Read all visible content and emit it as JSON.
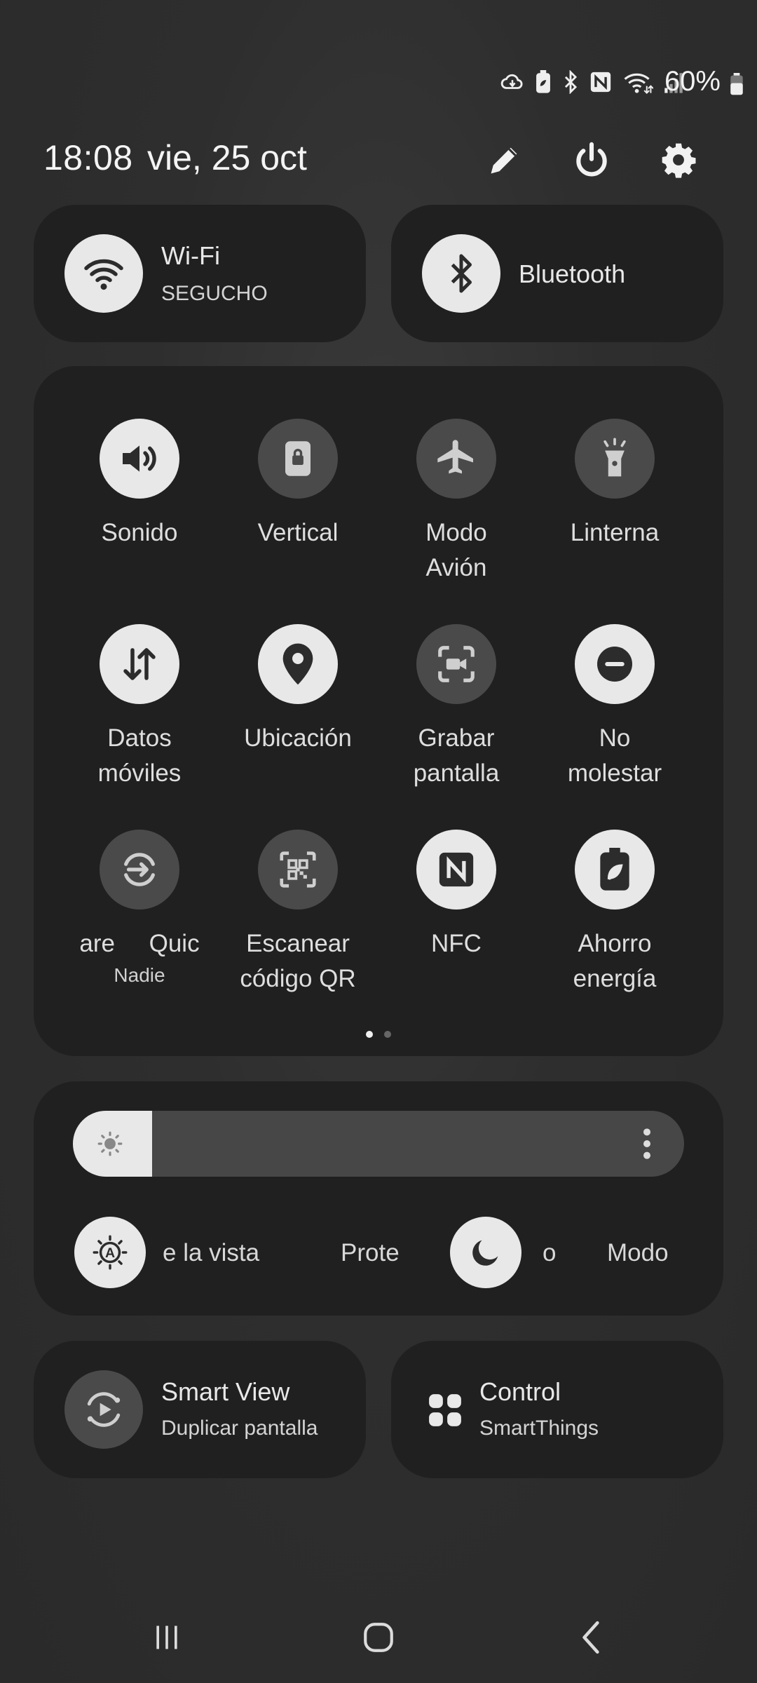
{
  "status_bar": {
    "battery_percent": "60%",
    "icons": [
      "sync-icon",
      "battery-saver-icon",
      "bluetooth-icon",
      "nfc-icon",
      "wifi-icon",
      "signal-icon",
      "battery-icon"
    ]
  },
  "header": {
    "time": "18:08",
    "date": "vie, 25 oct",
    "buttons": [
      "edit-icon",
      "power-icon",
      "settings-icon"
    ]
  },
  "top_pills": {
    "wifi": {
      "title": "Wi-Fi",
      "subtitle": "SEGUCHO"
    },
    "bluetooth": {
      "title": "Bluetooth"
    }
  },
  "tiles": [
    {
      "label": "Sonido",
      "icon": "sound-icon",
      "active": true
    },
    {
      "label": "Vertical",
      "icon": "rotation-lock-icon",
      "active": false
    },
    {
      "label": "Modo\nAvión",
      "icon": "airplane-icon",
      "active": false
    },
    {
      "label": "Linterna",
      "icon": "flashlight-icon",
      "active": false
    },
    {
      "label": "Datos\nmóviles",
      "icon": "mobile-data-icon",
      "active": true
    },
    {
      "label": "Ubicación",
      "icon": "location-icon",
      "active": true
    },
    {
      "label": "Grabar\npantalla",
      "icon": "screen-record-icon",
      "active": false
    },
    {
      "label": "No\nmolestar",
      "icon": "do-not-disturb-icon",
      "active": true
    },
    {
      "label": "are     Quic",
      "sublabel": "Nadie",
      "icon": "quick-share-icon",
      "active": false
    },
    {
      "label": "Escanear\ncódigo QR",
      "icon": "qr-scan-icon",
      "active": false
    },
    {
      "label": "NFC",
      "icon": "nfc-icon",
      "active": true
    },
    {
      "label": "Ahorro\nenergía",
      "icon": "power-saving-icon",
      "active": true
    }
  ],
  "page_indicator": {
    "current": 1,
    "total": 2
  },
  "brightness": {
    "level": 0.13,
    "eye_comfort_label_fragment": "e la vista",
    "protect_label_fragment": "Prote",
    "dark_mode_label_fragment": "o",
    "mode_label_fragment": "Modo"
  },
  "bottom_pills": {
    "smart_view": {
      "title": "Smart View",
      "subtitle": "Duplicar pantalla"
    },
    "control": {
      "title": "Control",
      "subtitle": "SmartThings"
    }
  },
  "nav_bar": [
    "recents-icon",
    "home-icon",
    "back-icon"
  ]
}
